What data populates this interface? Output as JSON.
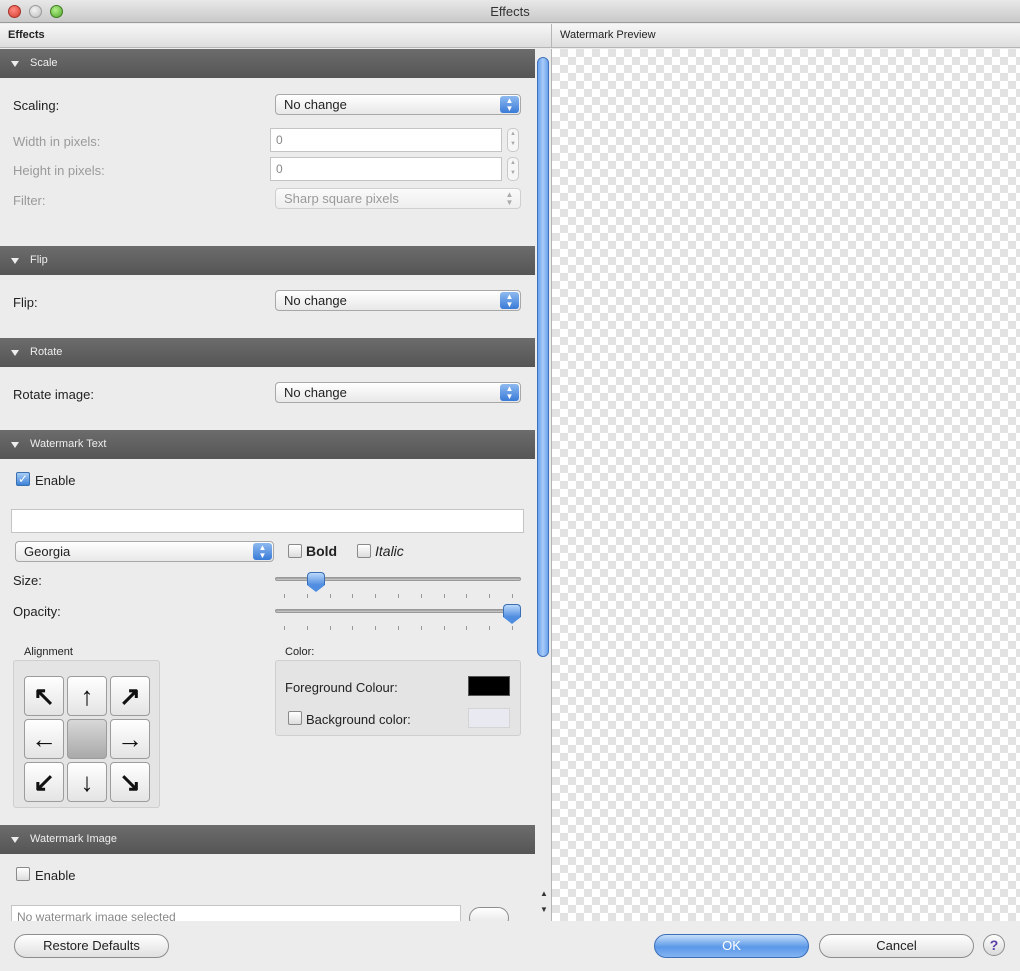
{
  "window": {
    "title": "Effects"
  },
  "headers": {
    "left": "Effects",
    "right": "Watermark Preview"
  },
  "scale": {
    "header": "Scale",
    "scaling_label": "Scaling:",
    "scaling_value": "No change",
    "width_label": "Width in pixels:",
    "width_value": "0",
    "height_label": "Height in pixels:",
    "height_value": "0",
    "filter_label": "Filter:",
    "filter_value": "Sharp square pixels"
  },
  "flip": {
    "header": "Flip",
    "label": "Flip:",
    "value": "No change"
  },
  "rotate": {
    "header": "Rotate",
    "label": "Rotate image:",
    "value": "No change"
  },
  "watermark_text": {
    "header": "Watermark Text",
    "enable_label": "Enable",
    "enable_checked": true,
    "text_value": "",
    "font_value": "Georgia",
    "bold_label": "Bold",
    "italic_label": "Italic",
    "size_label": "Size:",
    "size_level": 0.14,
    "opacity_label": "Opacity:",
    "opacity_level": 1.0,
    "alignment_label": "Alignment",
    "alignment_arrows": [
      "↖",
      "↑",
      "↗",
      "←",
      "",
      "→",
      "↙",
      "↓",
      "↘"
    ],
    "color_label": "Color:",
    "foreground_label": "Foreground Colour:",
    "foreground_color": "#000000",
    "background_label": "Background color:",
    "background_checked": false
  },
  "watermark_image": {
    "header": "Watermark Image",
    "enable_label": "Enable",
    "enable_checked": false,
    "path_placeholder": "No watermark image selected"
  },
  "buttons": {
    "restore": "Restore Defaults",
    "ok": "OK",
    "cancel": "Cancel",
    "help": "?"
  }
}
